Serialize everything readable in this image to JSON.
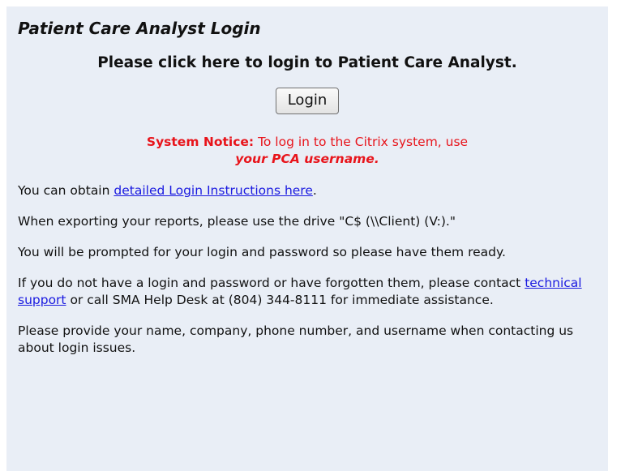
{
  "panel": {
    "title": "Patient Care Analyst Login",
    "prompt": "Please click here to login to Patient Care Analyst.",
    "login_button": "Login"
  },
  "notice": {
    "label": "System Notice:",
    "text": "To log in to the Citrix system, use",
    "emphasis": "your PCA username",
    "end": "."
  },
  "paragraphs": {
    "instructions_prefix": "You can obtain ",
    "instructions_link": "detailed Login Instructions here",
    "instructions_suffix": ".",
    "export": "When exporting your reports, please use the drive \"C$ (\\\\Client) (V:).\"",
    "prompted": "You will be prompted for your login and password so please have them ready.",
    "support_prefix": "If you do not have a login and password or have forgotten them, please contact ",
    "support_link": "technical support",
    "support_suffix": " or call SMA Help Desk at (804) 344-8111 for immediate assistance.",
    "provide": "Please provide your name, company, phone number, and username when contacting us about login issues."
  },
  "colors": {
    "panel_background": "#e9eef6",
    "notice": "#e8141b",
    "link": "#1a1ae0"
  }
}
